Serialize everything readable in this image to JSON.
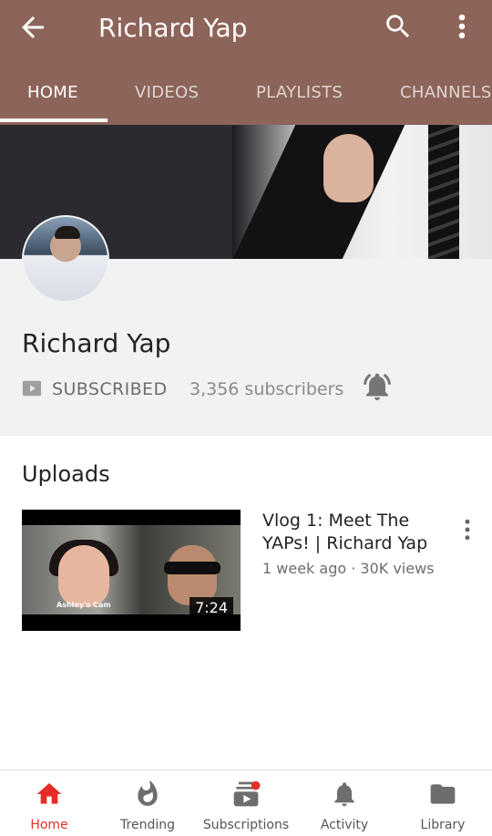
{
  "appbar": {
    "title": "Richard Yap",
    "back_icon": "arrow-back-icon",
    "search_icon": "search-icon",
    "more_icon": "more-vert-icon",
    "color": "#8d6459"
  },
  "tabs": [
    {
      "label": "HOME",
      "active": true
    },
    {
      "label": "VIDEOS",
      "active": false
    },
    {
      "label": "PLAYLISTS",
      "active": false
    },
    {
      "label": "CHANNELS",
      "active": false
    }
  ],
  "channel": {
    "name": "Richard Yap",
    "subscribed_label": "SUBSCRIBED",
    "subscriber_count": "3,356 subscribers",
    "bell_icon": "notifications-active-icon"
  },
  "uploads": {
    "title": "Uploads",
    "videos": [
      {
        "title": "Vlog 1: Meet The YAPs! | Richard Yap",
        "meta": "1 week ago · 30K views",
        "duration": "7:24",
        "thumb_caption": "Ashley's Cam"
      }
    ]
  },
  "bottom_nav": [
    {
      "label": "Home",
      "icon": "home-icon",
      "active": true
    },
    {
      "label": "Trending",
      "icon": "flame-icon",
      "active": false
    },
    {
      "label": "Subscriptions",
      "icon": "subscriptions-icon",
      "active": false
    },
    {
      "label": "Activity",
      "icon": "bell-icon",
      "active": false
    },
    {
      "label": "Library",
      "icon": "folder-icon",
      "active": false
    }
  ],
  "colors": {
    "accent_red": "#e52d27",
    "header_bg": "#f2f2f2"
  }
}
